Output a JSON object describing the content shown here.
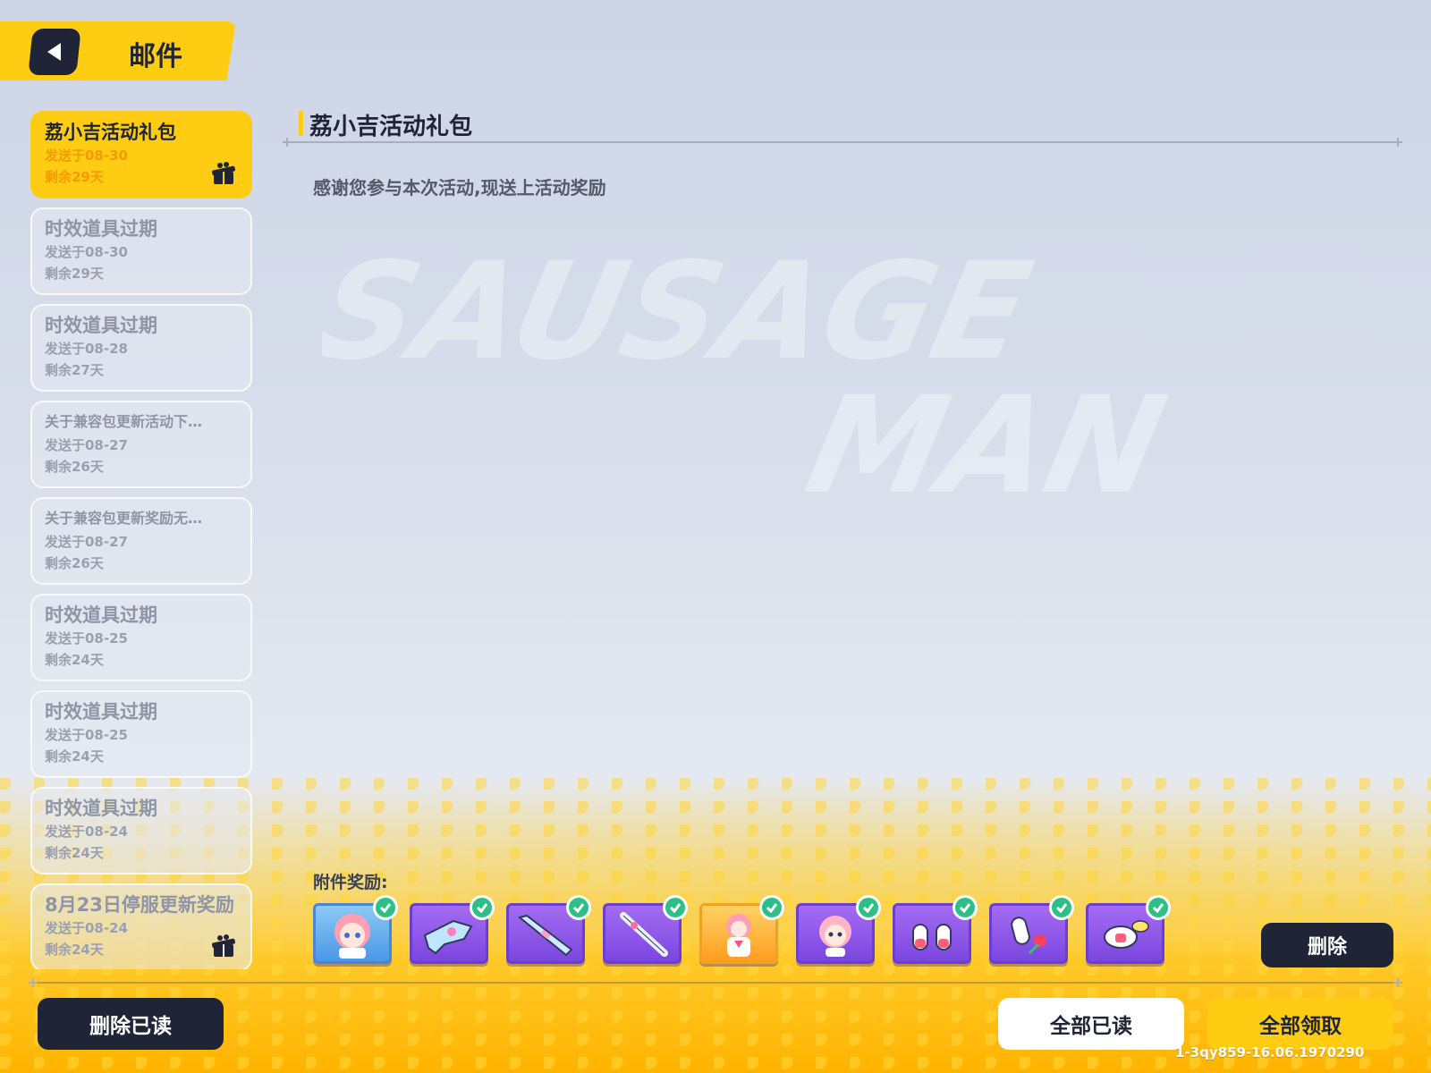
{
  "header": {
    "title": "邮件"
  },
  "mail_list": [
    {
      "title": "荔小吉活动礼包",
      "sent": "发送于08-30",
      "remaining": "剩余29天",
      "has_attachment": true,
      "active": true
    },
    {
      "title": "时效道具过期",
      "sent": "发送于08-30",
      "remaining": "剩余29天",
      "has_attachment": false
    },
    {
      "title": "时效道具过期",
      "sent": "发送于08-28",
      "remaining": "剩余27天",
      "has_attachment": false
    },
    {
      "title": "关于兼容包更新活动下…",
      "sent": "发送于08-27",
      "remaining": "剩余26天",
      "has_attachment": false
    },
    {
      "title": "关于兼容包更新奖励无…",
      "sent": "发送于08-27",
      "remaining": "剩余26天",
      "has_attachment": false
    },
    {
      "title": "时效道具过期",
      "sent": "发送于08-25",
      "remaining": "剩余24天",
      "has_attachment": false
    },
    {
      "title": "时效道具过期",
      "sent": "发送于08-25",
      "remaining": "剩余24天",
      "has_attachment": false
    },
    {
      "title": "时效道具过期",
      "sent": "发送于08-24",
      "remaining": "剩余24天",
      "has_attachment": false
    },
    {
      "title": "8月23日停服更新奖励",
      "sent": "发送于08-24",
      "remaining": "剩余24天",
      "has_attachment": true
    }
  ],
  "detail": {
    "title": "荔小吉活动礼包",
    "body": "感谢您参与本次活动,现送上活动奖励",
    "attachments_label": "附件奖励:",
    "rewards": [
      {
        "icon": "character-avatar-icon",
        "claimed": true,
        "frame": "blue"
      },
      {
        "icon": "blaster-gun-icon",
        "claimed": true,
        "frame": "purple"
      },
      {
        "icon": "rifle-icon",
        "claimed": true,
        "frame": "purple"
      },
      {
        "icon": "baseball-bat-icon",
        "claimed": true,
        "frame": "purple"
      },
      {
        "icon": "character-skin-icon",
        "claimed": true,
        "frame": "orange"
      },
      {
        "icon": "emote-sticker-icon",
        "claimed": true,
        "frame": "purple"
      },
      {
        "icon": "sausage-emote-icon",
        "claimed": true,
        "frame": "purple"
      },
      {
        "icon": "sausage-rose-icon",
        "claimed": true,
        "frame": "purple"
      },
      {
        "icon": "sausage-chat-icon",
        "claimed": true,
        "frame": "purple"
      }
    ]
  },
  "buttons": {
    "delete": "删除",
    "delete_read": "删除已读",
    "mark_all_read": "全部已读",
    "claim_all": "全部领取"
  },
  "background_watermark": [
    "SAUSAGE",
    "MAN"
  ],
  "version": "1-3qy859-16.06.1970290",
  "colors": {
    "accent": "#ffcc14",
    "dark": "#1f2536",
    "reward_purple": "#8a55e8",
    "claimed_green": "#2dbf88"
  }
}
